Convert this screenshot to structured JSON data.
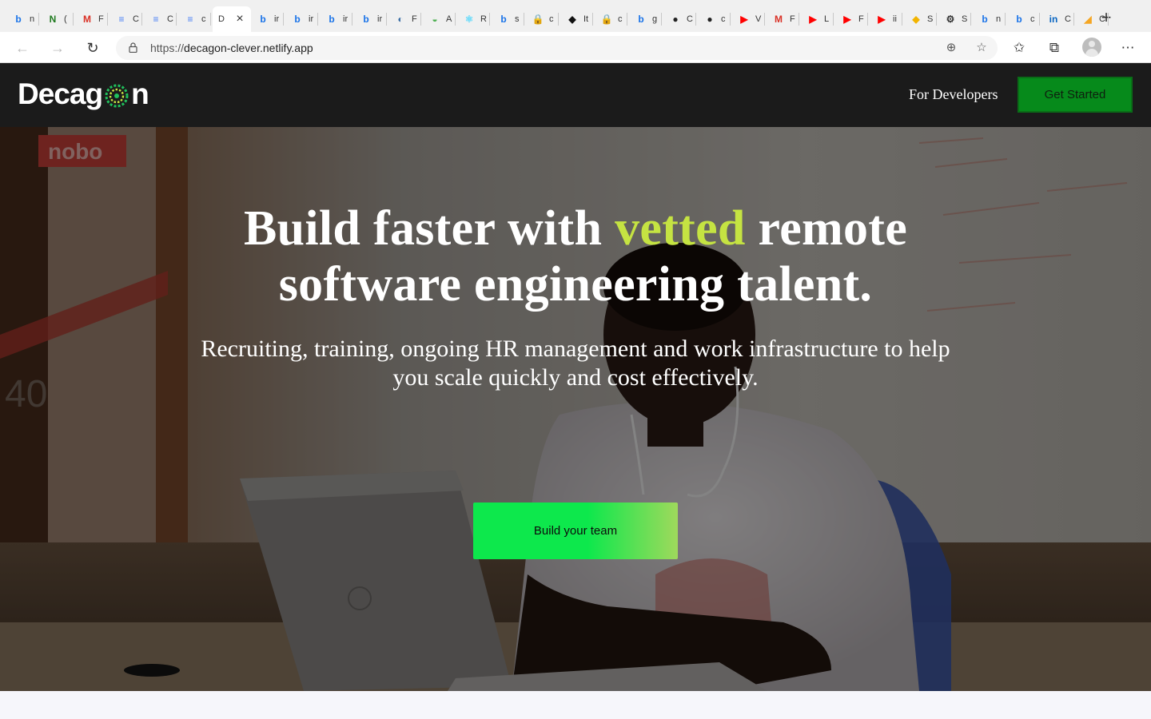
{
  "browser": {
    "tabs": [
      {
        "icon": "bing-icon",
        "label": "n",
        "glyph": "b",
        "color": "#1a73e8"
      },
      {
        "icon": "notion-n-icon",
        "label": "(",
        "glyph": "N",
        "color": "#1f7a1f"
      },
      {
        "icon": "gmail-icon",
        "label": "F",
        "glyph": "M",
        "color": "#d93025"
      },
      {
        "icon": "docs-icon",
        "label": "C",
        "glyph": "≡",
        "color": "#4a80f5"
      },
      {
        "icon": "docs-icon",
        "label": "C",
        "glyph": "≡",
        "color": "#4a80f5"
      },
      {
        "icon": "docs-icon",
        "label": "c",
        "glyph": "≡",
        "color": "#4a80f5"
      },
      {
        "icon": "bing-icon",
        "label": "ir",
        "glyph": "b",
        "color": "#1a73e8"
      },
      {
        "icon": "bing-icon",
        "label": "ir",
        "glyph": "b",
        "color": "#1a73e8"
      },
      {
        "icon": "bing-icon",
        "label": "ir",
        "glyph": "b",
        "color": "#1a73e8"
      },
      {
        "icon": "bing-icon",
        "label": "ir",
        "glyph": "b",
        "color": "#1a73e8"
      },
      {
        "icon": "globe-icon",
        "label": "F",
        "glyph": "◐",
        "color": "#3a6ea5"
      },
      {
        "icon": "landscape-icon",
        "label": "A",
        "glyph": "◒",
        "color": "#4caf50"
      },
      {
        "icon": "react-icon",
        "label": "R",
        "glyph": "⚛",
        "color": "#61dafb"
      },
      {
        "icon": "bing-icon",
        "label": "s",
        "glyph": "b",
        "color": "#1a73e8"
      },
      {
        "icon": "lock-doc-icon",
        "label": "c",
        "glyph": "🔒",
        "color": "#222222"
      },
      {
        "icon": "dark-square-icon",
        "label": "It",
        "glyph": "◆",
        "color": "#111111"
      },
      {
        "icon": "lock-doc-icon",
        "label": "c",
        "glyph": "🔒",
        "color": "#888888"
      },
      {
        "icon": "bing-icon",
        "label": "g",
        "glyph": "b",
        "color": "#1a73e8"
      },
      {
        "icon": "github-icon",
        "label": "C",
        "glyph": "●",
        "color": "#222222"
      },
      {
        "icon": "github-icon",
        "label": "c",
        "glyph": "●",
        "color": "#222222"
      },
      {
        "icon": "youtube-icon",
        "label": "V",
        "glyph": "▶",
        "color": "#ff0000"
      },
      {
        "icon": "gmail-icon",
        "label": "F",
        "glyph": "M",
        "color": "#d93025"
      },
      {
        "icon": "youtube-icon",
        "label": "L",
        "glyph": "▶",
        "color": "#ff0000"
      },
      {
        "icon": "youtube-icon",
        "label": "F",
        "glyph": "▶",
        "color": "#ff0000"
      },
      {
        "icon": "youtube-icon",
        "label": "ii",
        "glyph": "▶",
        "color": "#ff0000"
      },
      {
        "icon": "diamond-icon",
        "label": "S",
        "glyph": "◆",
        "color": "#f2b400"
      },
      {
        "icon": "gear-icon",
        "label": "S",
        "glyph": "⚙",
        "color": "#333333"
      },
      {
        "icon": "bing-icon",
        "label": "n",
        "glyph": "b",
        "color": "#1a73e8"
      },
      {
        "icon": "bing-icon",
        "label": "c",
        "glyph": "b",
        "color": "#1a73e8"
      },
      {
        "icon": "linkedin-icon",
        "label": "C",
        "glyph": "in",
        "color": "#0a66c2"
      },
      {
        "icon": "orange-app-icon",
        "label": "C",
        "glyph": "◢",
        "color": "#f5a623"
      }
    ],
    "active_tab": {
      "label": "D",
      "glyph": "D",
      "position": 6
    },
    "url_prefix": "https://",
    "url_host": "decagon-clever.netlify.app"
  },
  "site": {
    "logo_text_left": "Decag",
    "logo_text_right": "n",
    "nav_link": "For Developers",
    "nav_cta": "Get Started",
    "headline_part1": "Build faster with ",
    "headline_accent": "vetted",
    "headline_part2": " remote software engineering talent.",
    "subheadline": "Recruiting, training, ongoing HR management and work infrastructure to help you scale quickly and cost effectively.",
    "hero_cta": "Build your team",
    "colors": {
      "nav_background": "#1b1b1b",
      "accent_text": "#c5e342",
      "nav_cta_background": "#068a1b",
      "hero_cta_start": "#0de84c",
      "hero_cta_end": "#9fd95c",
      "page_background": "#f6f6fb"
    },
    "hero_photo": "developer-at-laptop-photo",
    "photo_whiteboard_brand": "nobo",
    "photo_partial_number": "40"
  }
}
